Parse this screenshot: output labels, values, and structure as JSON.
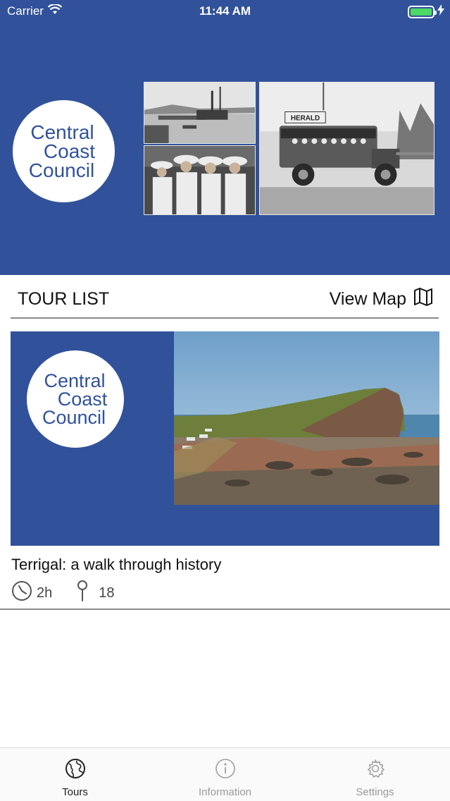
{
  "status_bar": {
    "carrier": "Carrier",
    "time": "11:44 AM",
    "icons": [
      "wifi-icon",
      "battery-icon",
      "charging-bolt-icon"
    ]
  },
  "header": {
    "logo": {
      "line1": "Central",
      "line2": "Coast",
      "line3": "Council"
    },
    "background_color": "#31529a",
    "photo_sign_text": "HERALD"
  },
  "section": {
    "title": "TOUR LIST",
    "view_map_label": "View Map"
  },
  "tours": [
    {
      "logo": {
        "line1": "Central",
        "line2": "Coast",
        "line3": "Council"
      },
      "title": "Terrigal: a walk through history",
      "duration": "2h",
      "stops": "18"
    }
  ],
  "tab_bar": {
    "tabs": [
      {
        "label": "Tours",
        "icon": "globe-icon",
        "active": true
      },
      {
        "label": "Information",
        "icon": "info-icon",
        "active": false
      },
      {
        "label": "Settings",
        "icon": "gear-icon",
        "active": false
      }
    ]
  }
}
